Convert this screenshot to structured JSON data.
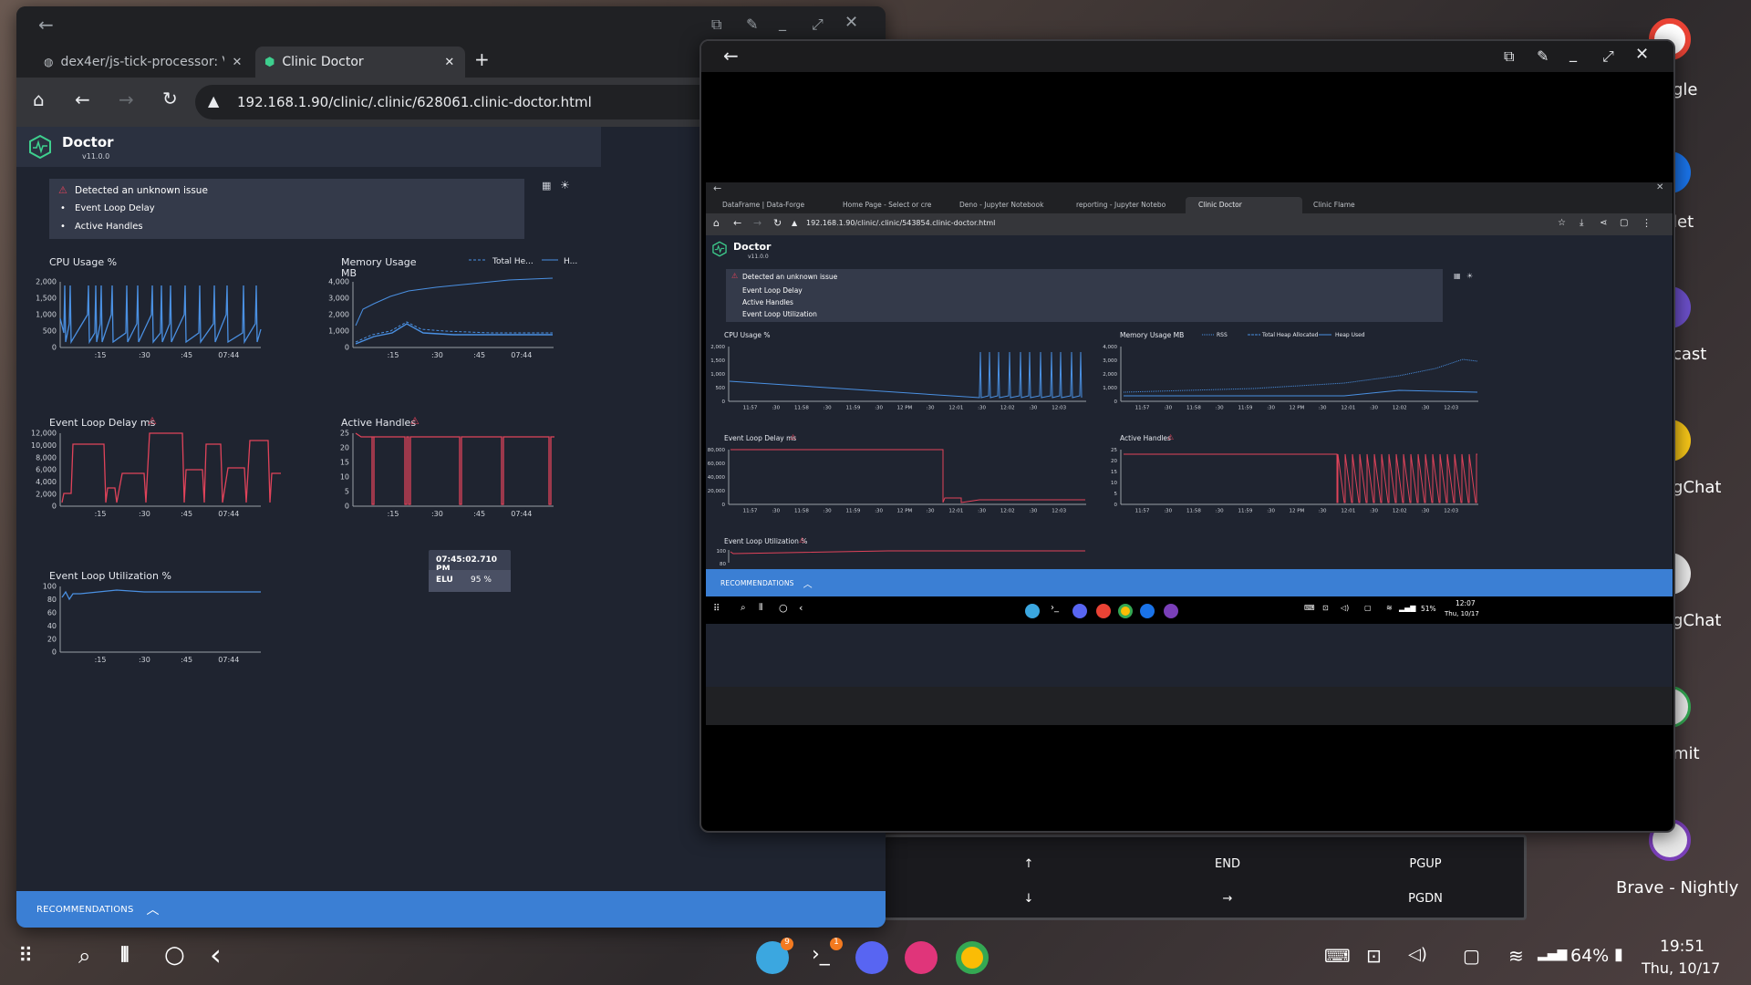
{
  "left_window": {
    "tabs": [
      {
        "label": "dex4er/js-tick-processor: V"
      },
      {
        "label": "Clinic Doctor"
      }
    ],
    "url": "192.168.1.90/clinic/.clinic/628061.clinic-doctor.html",
    "app": {
      "name": "Doctor",
      "version": "v11.0.0"
    },
    "alert": {
      "title": "Detected an unknown issue",
      "items": [
        "Event Loop Delay",
        "Active Handles"
      ]
    },
    "charts": {
      "cpu": {
        "title": "CPU Usage %",
        "yticks": [
          "2,000",
          "1,500",
          "1,000",
          "500",
          "0"
        ],
        "xticks": [
          ":15",
          ":30",
          ":45",
          "07:44"
        ]
      },
      "memory": {
        "title_line1": "Memory Usage",
        "title_line2": "MB",
        "legend": [
          "Total He...",
          "H..."
        ],
        "yticks": [
          "4,000",
          "3,000",
          "2,000",
          "1,000",
          "0"
        ],
        "xticks": [
          ":15",
          ":30",
          ":45",
          "07:44"
        ]
      },
      "eld": {
        "title": "Event Loop Delay ms",
        "yticks": [
          "12,000",
          "10,000",
          "8,000",
          "6,000",
          "4,000",
          "2,000",
          "0"
        ],
        "xticks": [
          ":15",
          ":30",
          ":45",
          "07:44"
        ]
      },
      "handles": {
        "title": "Active Handles",
        "yticks": [
          "25",
          "20",
          "15",
          "10",
          "5",
          "0"
        ],
        "xticks": [
          ":15",
          ":30",
          ":45",
          "07:44"
        ]
      },
      "elu": {
        "title": "Event Loop Utilization %",
        "yticks": [
          "100",
          "80",
          "60",
          "40",
          "20",
          "0"
        ],
        "xticks": [
          ":15",
          ":30",
          ":45",
          "07:44"
        ]
      }
    },
    "tooltip": {
      "time": "07:45:02.710 PM",
      "label": "ELU",
      "value": "95 %"
    },
    "recommendations": "RECOMMENDATIONS"
  },
  "right_window": {
    "inner_tabs": [
      "DataFrame | Data-Forge",
      "Home Page - Select or cre",
      "Deno - Jupyter Notebook",
      "reporting - Jupyter Notebo",
      "Clinic Doctor",
      "Clinic Flame"
    ],
    "url": "192.168.1.90/clinic/.clinic/543854.clinic-doctor.html",
    "app": {
      "name": "Doctor",
      "version": "v11.0.0"
    },
    "alert": {
      "title": "Detected an unknown issue",
      "items": [
        "Event Loop Delay",
        "Active Handles",
        "Event Loop Utilization"
      ]
    },
    "charts": {
      "cpu": {
        "title": "CPU Usage %",
        "yticks": [
          "2,000",
          "1,500",
          "1,000",
          "500",
          "0"
        ]
      },
      "memory": {
        "title": "Memory Usage MB",
        "legend": [
          "RSS",
          "Total Heap Allocated",
          "Heap Used"
        ],
        "yticks": [
          "4,000",
          "3,000",
          "2,000",
          "1,000",
          "0"
        ]
      },
      "eld": {
        "title": "Event Loop Delay ms",
        "yticks": [
          "80,000",
          "60,000",
          "40,000",
          "20,000",
          "0"
        ]
      },
      "handles": {
        "title": "Active Handles",
        "yticks": [
          "25",
          "20",
          "15",
          "10",
          "5",
          "0"
        ]
      },
      "elu": {
        "title": "Event Loop Utilization %",
        "yticks": [
          "100",
          "80"
        ]
      }
    },
    "xticks": [
      "11:57",
      ":30",
      "11:58",
      ":30",
      "11:59",
      ":30",
      "12 PM",
      ":30",
      "12:01",
      ":30",
      "12:02",
      ":30",
      "12:03"
    ],
    "recommendations": "RECOMMENDATIONS",
    "inner_status": {
      "battery": "51%",
      "time": "12:07",
      "date": "Thu, 10/17"
    }
  },
  "keyboard": {
    "row1": [
      "↑",
      "END",
      "PGUP"
    ],
    "row2": [
      "↓",
      "→",
      "PGDN"
    ]
  },
  "desktop_labels": [
    "gle",
    "let",
    "cast",
    "gChat",
    "gChat",
    "mit",
    "Brave - Nightly"
  ],
  "taskbar": {
    "badge_telegram": "9",
    "badge_terminal": "1",
    "battery": "64%",
    "time": "19:51",
    "date": "Thu, 10/17"
  },
  "colors": {
    "blue": "#4a90e2",
    "red": "#e0435a",
    "panel": "#2b3140",
    "bg": "#1f2430",
    "rec": "#3b7fd4"
  }
}
